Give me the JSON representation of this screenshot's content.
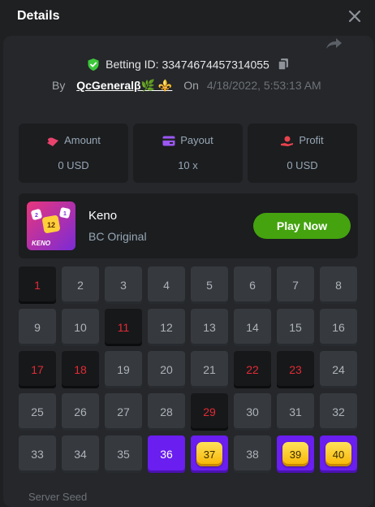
{
  "header": {
    "title": "Details"
  },
  "bet": {
    "id_label": "Betting ID:",
    "id_value": "33474674457314055",
    "by_label": "By",
    "username": "QcGeneralβ🌿 ⚜️",
    "on_label": "On",
    "date": "4/18/2022, 5:53:13 AM"
  },
  "stats": [
    {
      "label": "Amount",
      "value": "0 USD",
      "icon": "coins-icon",
      "color": "#e8436d"
    },
    {
      "label": "Payout",
      "value": "10 x",
      "icon": "card-icon",
      "color": "#9b57f5"
    },
    {
      "label": "Profit",
      "value": "0 USD",
      "icon": "hand-coin-icon",
      "color": "#e8434d"
    }
  ],
  "game": {
    "name": "Keno",
    "provider": "BC Original",
    "play_label": "Play Now",
    "thumb_text": "KENO",
    "thumb_numbers": [
      "12",
      "2",
      "1"
    ]
  },
  "board": {
    "numbers": [
      "1",
      "2",
      "3",
      "4",
      "5",
      "6",
      "7",
      "8",
      "9",
      "10",
      "11",
      "12",
      "13",
      "14",
      "15",
      "16",
      "17",
      "18",
      "19",
      "20",
      "21",
      "22",
      "23",
      "24",
      "25",
      "26",
      "27",
      "28",
      "29",
      "30",
      "31",
      "32",
      "33",
      "34",
      "35",
      "36",
      "37",
      "38",
      "39",
      "40"
    ],
    "drawn_only": [
      "1",
      "11",
      "17",
      "18",
      "22",
      "23",
      "29"
    ],
    "picked_only": [
      "36"
    ],
    "matched": [
      "37",
      "39",
      "40"
    ]
  },
  "footer": {
    "label": "Server Seed"
  },
  "colors": {
    "accent": "#6a1eef",
    "play": "#44a30f",
    "hit_text": "#e22b35",
    "gold": "#f7b400"
  }
}
